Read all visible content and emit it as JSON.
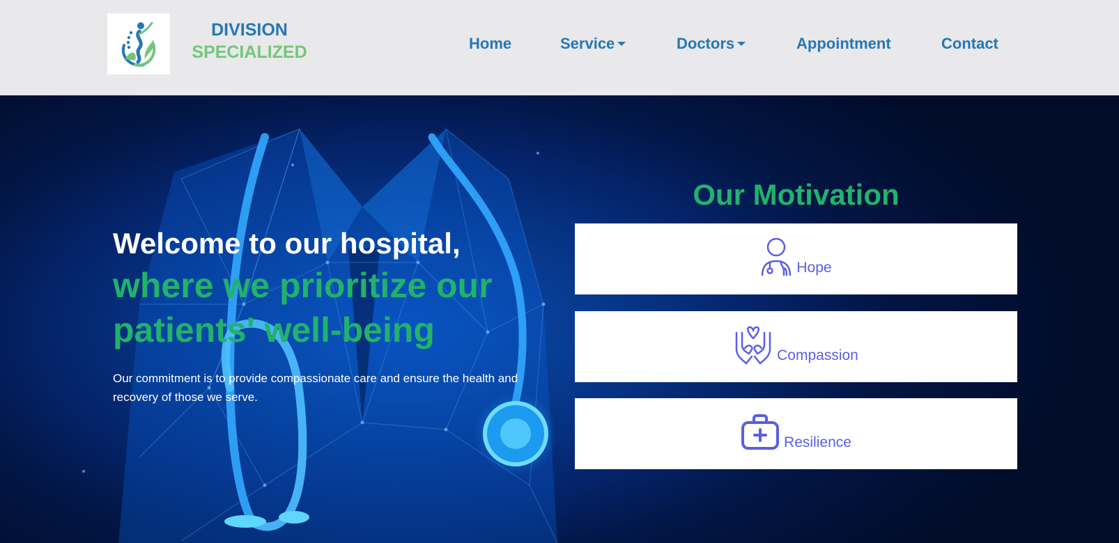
{
  "brand": {
    "line1": "DIVISION",
    "line2": "SPECIALIZED"
  },
  "nav": {
    "home": "Home",
    "service": "Service",
    "doctors": "Doctors",
    "appointment": "Appointment",
    "contact": "Contact"
  },
  "hero": {
    "welcome": "Welcome to our hospital,",
    "tagline": "where we prioritize our patients' well-being",
    "commitment": "Our commitment is to provide compassionate care and ensure the health and recovery of those we serve."
  },
  "motivation": {
    "title": "Our Motivation",
    "cards": [
      {
        "label": "Hope",
        "icon": "doctor-icon"
      },
      {
        "label": "Compassion",
        "icon": "caring-hands-icon"
      },
      {
        "label": "Resilience",
        "icon": "first-aid-kit-icon"
      }
    ]
  },
  "colors": {
    "header_bg": "#e9e8ea",
    "brand_blue": "#2478b5",
    "brand_green": "#72c77a",
    "accent_green": "#21b26b",
    "card_icon": "#5a5ee3",
    "hero_dark": "#011033"
  }
}
